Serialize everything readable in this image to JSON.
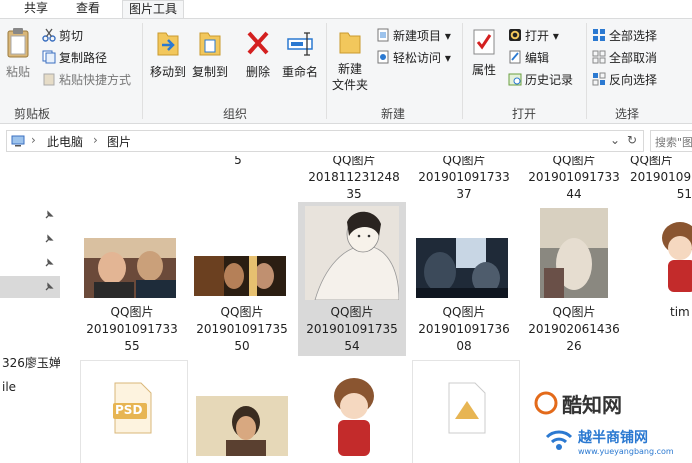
{
  "tabs": [
    "共享",
    "查看",
    "图片工具"
  ],
  "ribbon": {
    "clipboard": {
      "paste_label": "粘贴",
      "cut_label": "剪切",
      "copy_path_label": "复制路径",
      "paste_shortcut_label": "粘贴快捷方式",
      "group_label": "剪贴板"
    },
    "organize": {
      "move_to_label": "移动到",
      "copy_to_label": "复制到",
      "delete_label": "删除",
      "rename_label": "重命名",
      "group_label": "组织"
    },
    "new": {
      "new_folder_label": "新建\n文件夹",
      "new_item_label": "新建项目",
      "easy_access_label": "轻松访问",
      "group_label": "新建"
    },
    "open": {
      "properties_label": "属性",
      "open_label": "打开",
      "edit_label": "编辑",
      "history_label": "历史记录",
      "group_label": "打开"
    },
    "select": {
      "select_all_label": "全部选择",
      "select_none_label": "全部取消",
      "invert_label": "反向选择",
      "group_label": "选择"
    }
  },
  "address": {
    "computer": "此电脑",
    "folder": "图片",
    "search_placeholder": "搜索\"图"
  },
  "nav": {
    "items": [
      "326廖玉婵",
      "ile"
    ]
  },
  "files": {
    "row0": [
      {
        "line1": "5",
        "line2": ""
      },
      {
        "line1": "QQ图片",
        "line2": "201811231248",
        "line3": "35"
      },
      {
        "line1": "QQ图片",
        "line2": "201901091733",
        "line3": "37"
      },
      {
        "line1": "QQ图片",
        "line2": "201901091733",
        "line3": "44"
      },
      {
        "line1": "QQ图片",
        "line2": "20190109173",
        "line3": "51"
      }
    ],
    "row1": [
      {
        "line1": "QQ图片",
        "line2": "201901091733",
        "line3": "55"
      },
      {
        "line1": "QQ图片",
        "line2": "201901091735",
        "line3": "50"
      },
      {
        "line1": "QQ图片",
        "line2": "201901091735",
        "line3": "54"
      },
      {
        "line1": "QQ图片",
        "line2": "201901091736",
        "line3": "08"
      },
      {
        "line1": "QQ图片",
        "line2": "201902061436",
        "line3": "26"
      },
      {
        "line1": "tim",
        "line2": "",
        "line3": ""
      }
    ],
    "psd_label": "PSD"
  },
  "watermark": {
    "brand_cn": "酷知网",
    "brand_cn2": "越半商铺网",
    "url": "www.yueyangbang.com"
  },
  "colors": {
    "ribbon_bg": "#f5f6f7",
    "selection": "#d9d9d9",
    "accent_blue": "#2b79d1"
  }
}
